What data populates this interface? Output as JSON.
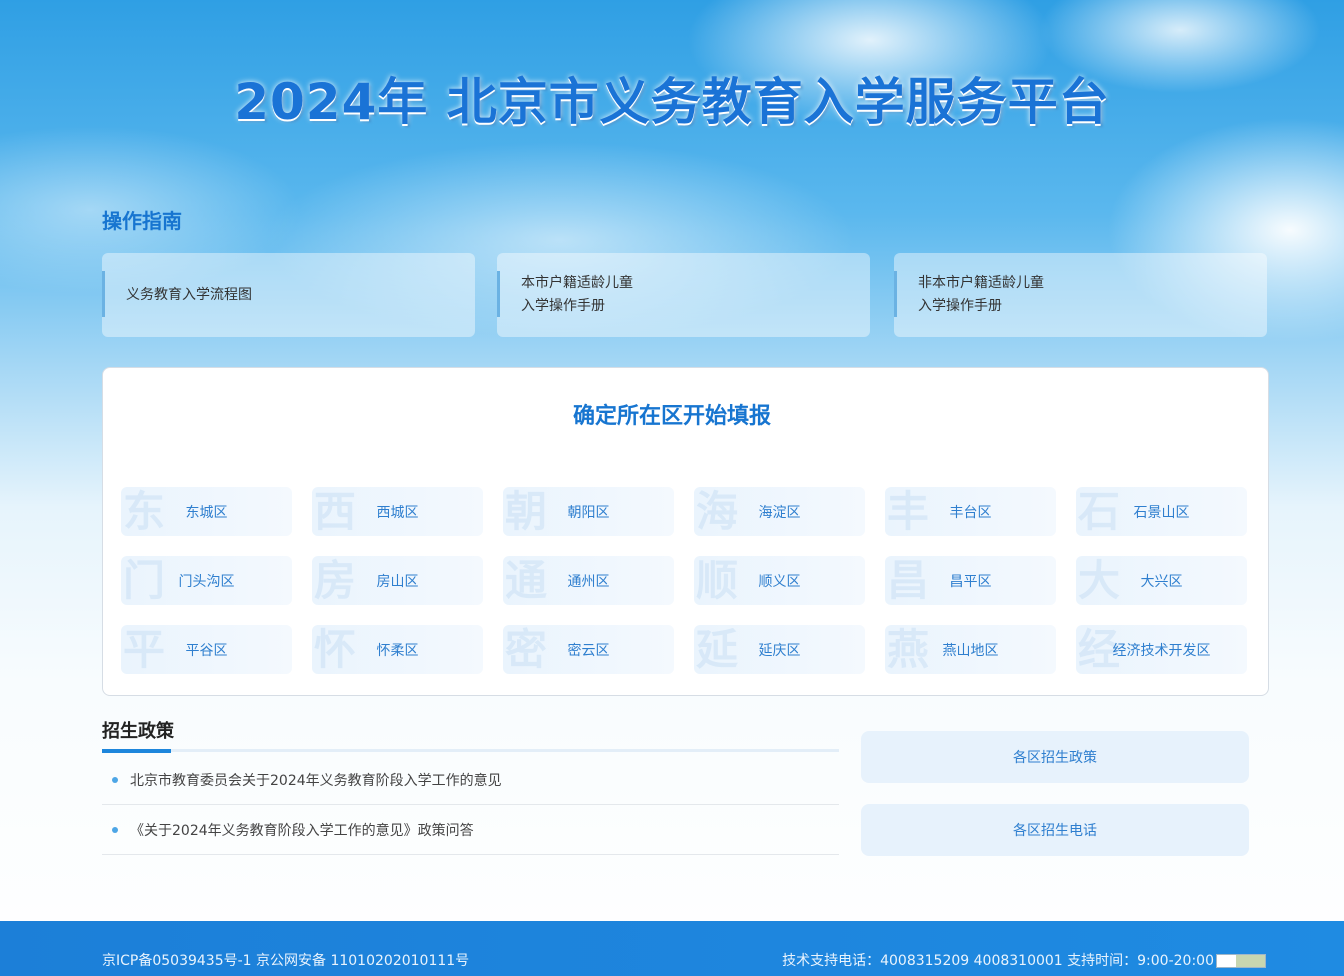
{
  "header": {
    "title": "2024年 北京市义务教育入学服务平台"
  },
  "guide": {
    "title": "操作指南",
    "items": [
      {
        "label": "义务教育入学流程图"
      },
      {
        "label": "本市户籍适龄儿童\n入学操作手册"
      },
      {
        "label": "非本市户籍适龄儿童\n入学操作手册"
      }
    ]
  },
  "district_panel": {
    "title": "确定所在区开始填报",
    "districts": [
      {
        "label": "东城区",
        "watermark": "东"
      },
      {
        "label": "西城区",
        "watermark": "西"
      },
      {
        "label": "朝阳区",
        "watermark": "朝"
      },
      {
        "label": "海淀区",
        "watermark": "海"
      },
      {
        "label": "丰台区",
        "watermark": "丰"
      },
      {
        "label": "石景山区",
        "watermark": "石"
      },
      {
        "label": "门头沟区",
        "watermark": "门"
      },
      {
        "label": "房山区",
        "watermark": "房"
      },
      {
        "label": "通州区",
        "watermark": "通"
      },
      {
        "label": "顺义区",
        "watermark": "顺"
      },
      {
        "label": "昌平区",
        "watermark": "昌"
      },
      {
        "label": "大兴区",
        "watermark": "大"
      },
      {
        "label": "平谷区",
        "watermark": "平"
      },
      {
        "label": "怀柔区",
        "watermark": "怀"
      },
      {
        "label": "密云区",
        "watermark": "密"
      },
      {
        "label": "延庆区",
        "watermark": "延"
      },
      {
        "label": "燕山地区",
        "watermark": "燕"
      },
      {
        "label": "经济技术开发区",
        "watermark": "经"
      }
    ]
  },
  "policy": {
    "title": "招生政策",
    "items": [
      {
        "label": "北京市教育委员会关于2024年义务教育阶段入学工作的意见"
      },
      {
        "label": "《关于2024年义务教育阶段入学工作的意见》政策问答"
      }
    ],
    "side_buttons": [
      {
        "label": "各区招生政策"
      },
      {
        "label": "各区招生电话"
      }
    ]
  },
  "footer": {
    "icp": "京ICP备05039435号-1 京公网安备 11010202010111号",
    "support": "技术支持电话：4008315209 4008310001 支持时间：9:00-20:00"
  },
  "colors": {
    "brand": "#1775d0",
    "footer": "#1d86dc"
  }
}
